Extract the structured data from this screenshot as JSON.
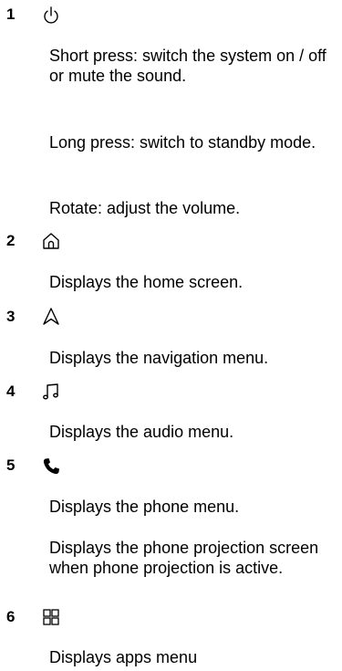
{
  "items": [
    {
      "number": "1",
      "icon": "power-icon",
      "paragraphs": [
        "Short press: switch the system on / off or mute the sound.",
        "Long press: switch to standby mode.",
        "Rotate: adjust the volume."
      ]
    },
    {
      "number": "2",
      "icon": "home-icon",
      "paragraphs": [
        "Displays the home screen."
      ]
    },
    {
      "number": "3",
      "icon": "navigation-icon",
      "paragraphs": [
        "Displays the navigation menu."
      ]
    },
    {
      "number": "4",
      "icon": "music-note-icon",
      "paragraphs": [
        "Displays the audio menu."
      ]
    },
    {
      "number": "5",
      "icon": "phone-icon",
      "paragraphs": [
        "Displays the phone menu.",
        "Displays the phone projection screen when phone projection is active."
      ]
    },
    {
      "number": "6",
      "icon": "apps-grid-icon",
      "paragraphs": [
        "Displays apps menu"
      ]
    }
  ]
}
